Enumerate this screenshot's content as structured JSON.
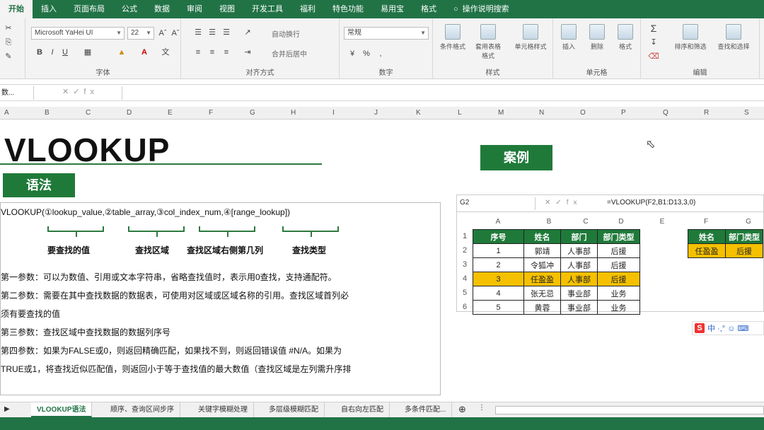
{
  "ribbon_tabs": [
    "开始",
    "插入",
    "页面布局",
    "公式",
    "数据",
    "审阅",
    "视图",
    "开发工具",
    "福利",
    "特色功能",
    "易用宝",
    "格式"
  ],
  "help_text": "操作说明搜索",
  "ribbon": {
    "font_name": "Microsoft YaHei UI",
    "font_size": "22",
    "number_format": "常规",
    "wrap_text": "自动换行",
    "merge_center": "合并后居中",
    "cond_format": "条件格式",
    "table_format": "套用表格格式",
    "cell_style": "单元格样式",
    "insert": "插入",
    "delete": "删除",
    "format": "格式",
    "sort_filter": "排序和筛选",
    "find_select": "查找和选择",
    "groups": {
      "font": "字体",
      "align": "对齐方式",
      "number": "数字",
      "styles": "样式",
      "cells": "单元格",
      "editing": "编辑"
    }
  },
  "formula_bar": {
    "name_box": "数...",
    "content": ""
  },
  "col_letters": [
    "A",
    "B",
    "C",
    "D",
    "E",
    "F",
    "G",
    "H",
    "I",
    "J",
    "K",
    "L",
    "M",
    "N",
    "O",
    "P",
    "Q",
    "R",
    "S"
  ],
  "title": "VLOOKUP",
  "syntax_header": "语法",
  "example_header": "案例",
  "syntax_line": "VLOOKUP(①lookup_value,②table_array,③col_index_num,④[range_lookup])",
  "arg_labels": [
    "要查找的值",
    "查找区域",
    "查找区域右侧第几列",
    "查找类型"
  ],
  "params": [
    "第一参数：可以为数值、引用或文本字符串，省略查找值时，表示用0查找，支持通配符。",
    "第二参数：需要在其中查找数据的数据表，可使用对区域或区域名称的引用。查找区域首列必",
    "须有要查找的值",
    "第三参数：查找区域中查找数据的数据列序号",
    "第四参数：如果为FALSE或0，则返回精确匹配，如果找不到，则返回错误值 #N/A。如果为",
    "TRUE或1，将查找近似匹配值，则返回小于等于查找值的最大数值（查找区域是左列需升序排"
  ],
  "example": {
    "name_box": "G2",
    "formula": "=VLOOKUP(F2,B1:D13,3,0)",
    "col_letters": [
      "A",
      "B",
      "C",
      "D",
      "E",
      "F",
      "G"
    ],
    "row_numbers": [
      "1",
      "2",
      "3",
      "4",
      "5",
      "6"
    ],
    "headers": [
      "序号",
      "姓名",
      "部门",
      "部门类型"
    ],
    "rows": [
      [
        "1",
        "郭靖",
        "人事部",
        "后援"
      ],
      [
        "2",
        "令狐冲",
        "人事部",
        "后援"
      ],
      [
        "3",
        "任盈盈",
        "人事部",
        "后援"
      ],
      [
        "4",
        "张无忌",
        "事业部",
        "业务"
      ],
      [
        "5",
        "黄蓉",
        "事业部",
        "业务"
      ]
    ],
    "lookup_headers": [
      "姓名",
      "部门类型"
    ],
    "lookup_row": [
      "任盈盈",
      "后援"
    ]
  },
  "ime": {
    "brand": "S",
    "text": "中 ·,° ☺ ⌨"
  },
  "sheet_tabs": [
    "VLOOKUP语法",
    "顺序、查询区间步序",
    "关键字模糊处理",
    "多层级模糊匹配",
    "自右向左匹配",
    "多条件匹配..."
  ],
  "colors": {
    "excel_green": "#217346",
    "header_green": "#1f7a3a",
    "highlight": "#f5c000"
  }
}
